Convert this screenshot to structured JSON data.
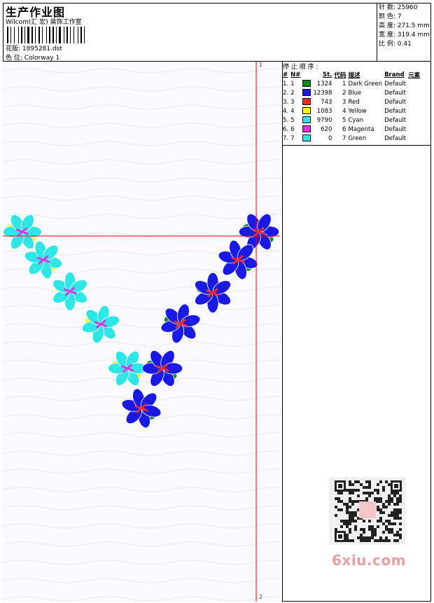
{
  "header": {
    "title": "生产作业图",
    "vendor": "Wilcom(汇 宏) 装饰工作室",
    "design_label": "花版:",
    "design_value": "1895281.dst",
    "colorway_label": "色 位:",
    "colorway_value": "Colorway 1"
  },
  "stats": {
    "stitches": "针 数: 25960",
    "colors": "颜 色: 7",
    "height": "高 度: 271.5 mm",
    "width": "宽 度: 319.4 mm",
    "scale": "比 例: 0.41"
  },
  "stop_sequence": {
    "title": "停 止 顺 序 :",
    "headers": [
      "#",
      "N#",
      "",
      "St.",
      "代码",
      "描述",
      "Brand",
      "元素"
    ],
    "rows": [
      {
        "idx": "1.",
        "n": "1",
        "color": "#0c8a1c",
        "st": "1324",
        "code": "1",
        "desc": "Dark Green",
        "brand": "Default"
      },
      {
        "idx": "2.",
        "n": "2",
        "color": "#1a1ae6",
        "st": "12398",
        "code": "2",
        "desc": "Blue",
        "brand": "Default"
      },
      {
        "idx": "3.",
        "n": "3",
        "color": "#ff2a1a",
        "st": "743",
        "code": "3",
        "desc": "Red",
        "brand": "Default"
      },
      {
        "idx": "4.",
        "n": "4",
        "color": "#ffff1a",
        "st": "1083",
        "code": "4",
        "desc": "Yellow",
        "brand": "Default"
      },
      {
        "idx": "5.",
        "n": "5",
        "color": "#2ee6e6",
        "st": "9790",
        "code": "5",
        "desc": "Cyan",
        "brand": "Default"
      },
      {
        "idx": "6.",
        "n": "6",
        "color": "#e62ee6",
        "st": "620",
        "code": "6",
        "desc": "Magenta",
        "brand": "Default"
      },
      {
        "idx": "7.",
        "n": "7",
        "color": "#2ee6e6",
        "st": "0",
        "code": "7",
        "desc": "Green",
        "brand": "Default"
      }
    ]
  },
  "ruler": {
    "top_label": "1",
    "bottom_label": "2"
  },
  "watermark": {
    "site": "6xiu.com"
  },
  "colors": {
    "guide_line": "#ff0000",
    "flower_left": "#2ee6e6",
    "flower_right": "#1a1ae6",
    "leaf": "#0c8a1c",
    "accent_red": "#ff2a1a",
    "accent_magenta": "#e62ee6",
    "accent_yellow": "#ffff1a"
  }
}
